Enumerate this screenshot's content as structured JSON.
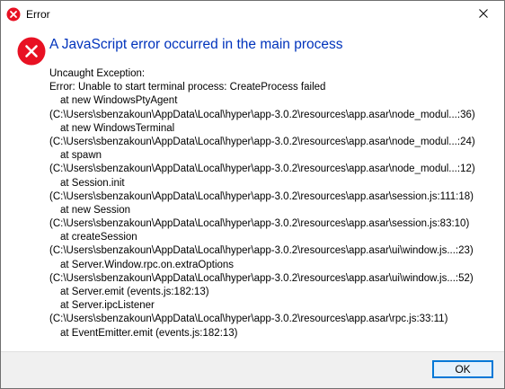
{
  "window": {
    "title": "Error"
  },
  "dialog": {
    "heading": "A JavaScript error occurred in the main process",
    "lines": [
      {
        "text": "Uncaught Exception:",
        "indent": false
      },
      {
        "text": "Error: Unable to start terminal process: CreateProcess failed",
        "indent": false
      },
      {
        "text": "at new WindowsPtyAgent",
        "indent": true
      },
      {
        "text": "(C:\\Users\\sbenzakoun\\AppData\\Local\\hyper\\app-3.0.2\\resources\\app.asar\\node_modul...:36)",
        "indent": false
      },
      {
        "text": "at new WindowsTerminal",
        "indent": true
      },
      {
        "text": "(C:\\Users\\sbenzakoun\\AppData\\Local\\hyper\\app-3.0.2\\resources\\app.asar\\node_modul...:24)",
        "indent": false
      },
      {
        "text": "at spawn",
        "indent": true
      },
      {
        "text": "(C:\\Users\\sbenzakoun\\AppData\\Local\\hyper\\app-3.0.2\\resources\\app.asar\\node_modul...:12)",
        "indent": false
      },
      {
        "text": "at Session.init",
        "indent": true
      },
      {
        "text": "(C:\\Users\\sbenzakoun\\AppData\\Local\\hyper\\app-3.0.2\\resources\\app.asar\\session.js:111:18)",
        "indent": false
      },
      {
        "text": "at new Session",
        "indent": true
      },
      {
        "text": "(C:\\Users\\sbenzakoun\\AppData\\Local\\hyper\\app-3.0.2\\resources\\app.asar\\session.js:83:10)",
        "indent": false
      },
      {
        "text": "at createSession",
        "indent": true
      },
      {
        "text": "(C:\\Users\\sbenzakoun\\AppData\\Local\\hyper\\app-3.0.2\\resources\\app.asar\\ui\\window.js...:23)",
        "indent": false
      },
      {
        "text": "at Server.Window.rpc.on.extraOptions",
        "indent": true
      },
      {
        "text": "(C:\\Users\\sbenzakoun\\AppData\\Local\\hyper\\app-3.0.2\\resources\\app.asar\\ui\\window.js...:52)",
        "indent": false
      },
      {
        "text": "at Server.emit (events.js:182:13)",
        "indent": true
      },
      {
        "text": "at Server.ipcListener",
        "indent": true
      },
      {
        "text": "(C:\\Users\\sbenzakoun\\AppData\\Local\\hyper\\app-3.0.2\\resources\\app.asar\\rpc.js:33:11)",
        "indent": false
      },
      {
        "text": "at EventEmitter.emit (events.js:182:13)",
        "indent": true
      }
    ]
  },
  "buttons": {
    "ok_label": "OK"
  },
  "icons": {
    "title": "error-icon",
    "main": "error-icon",
    "close": "close-icon"
  },
  "colors": {
    "error_red": "#e81123",
    "heading_blue": "#0033bc",
    "button_accent": "#0078d7",
    "footer_bg": "#f0f0f0"
  }
}
